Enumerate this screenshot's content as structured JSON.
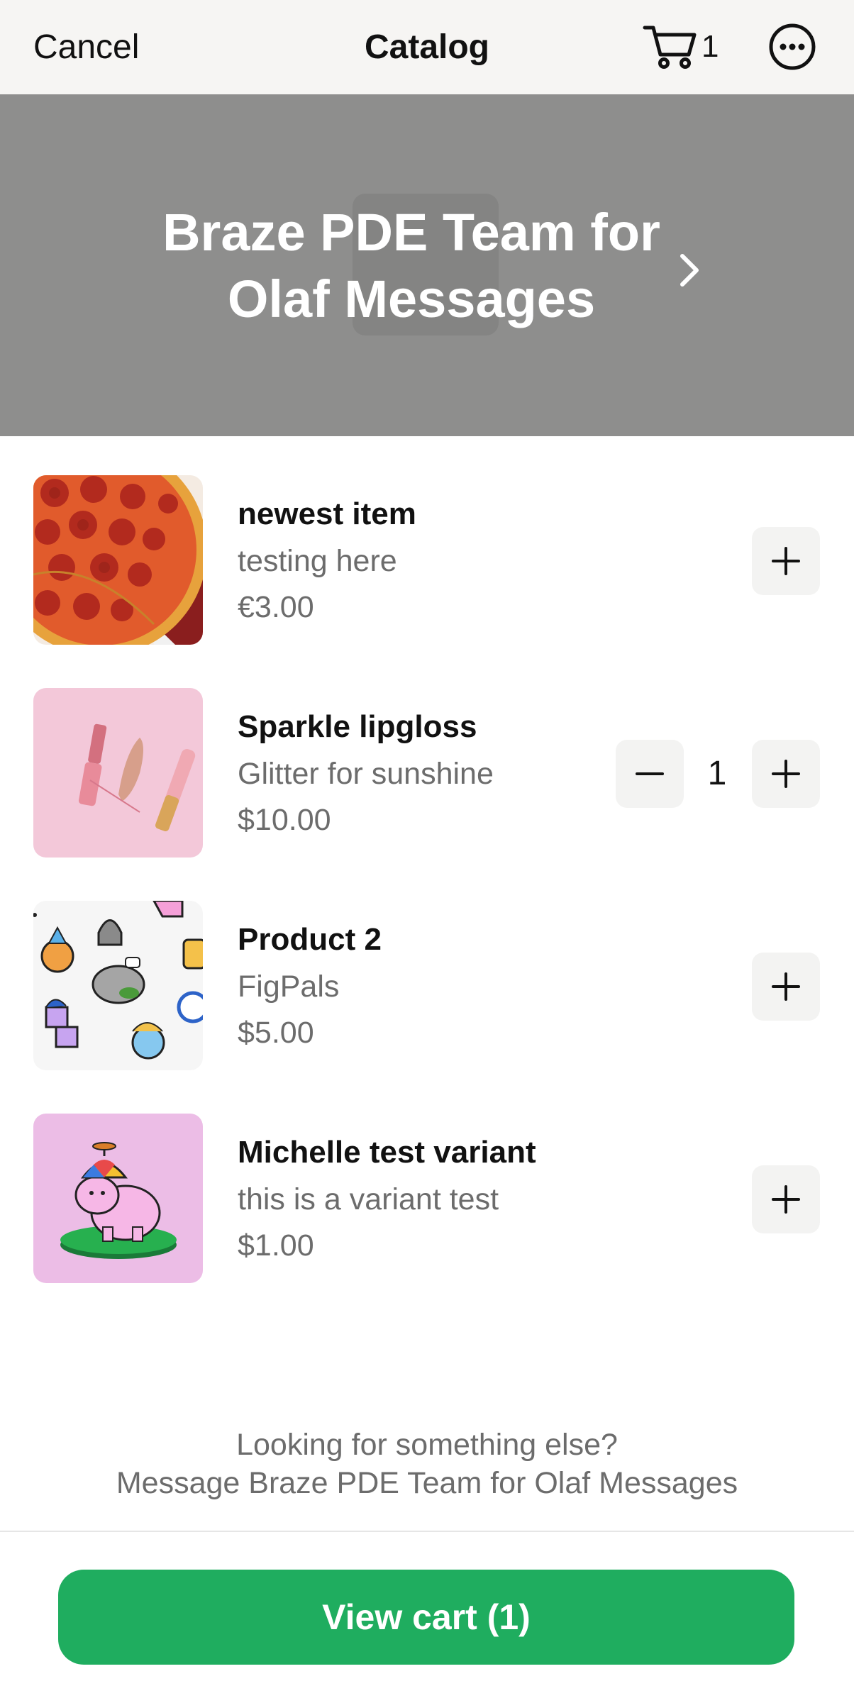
{
  "nav": {
    "cancel_label": "Cancel",
    "title": "Catalog",
    "cart_count": "1",
    "cart_icon": "cart-icon",
    "more_icon": "more-horizontal-circle-icon"
  },
  "banner": {
    "title": "Braze PDE Team for Olaf Messages",
    "chevron_icon": "chevron-right-icon"
  },
  "items": [
    {
      "name": "newest item",
      "description": "testing here",
      "price": "€3.00",
      "image": "pepperoni-pizza",
      "quantity": null
    },
    {
      "name": "Sparkle lipgloss",
      "description": "Glitter for sunshine",
      "price": "$10.00",
      "image": "lipgloss",
      "quantity": "1"
    },
    {
      "name": "Product 2",
      "description": "FigPals",
      "price": "$5.00",
      "image": "figpals-stickers",
      "quantity": null
    },
    {
      "name": "Michelle test variant",
      "description": "this is a variant test",
      "price": "$1.00",
      "image": "pink-hippo-propeller-hat",
      "quantity": null
    }
  ],
  "footer": {
    "question": "Looking for something else?",
    "message": "Message  Braze PDE Team for Olaf Messages"
  },
  "view_cart_label": "View cart (1)",
  "colors": {
    "accent": "#1fad5f",
    "banner": "#8e8e8d",
    "navbar": "#f6f5f3",
    "button_bg": "#f3f3f2"
  }
}
